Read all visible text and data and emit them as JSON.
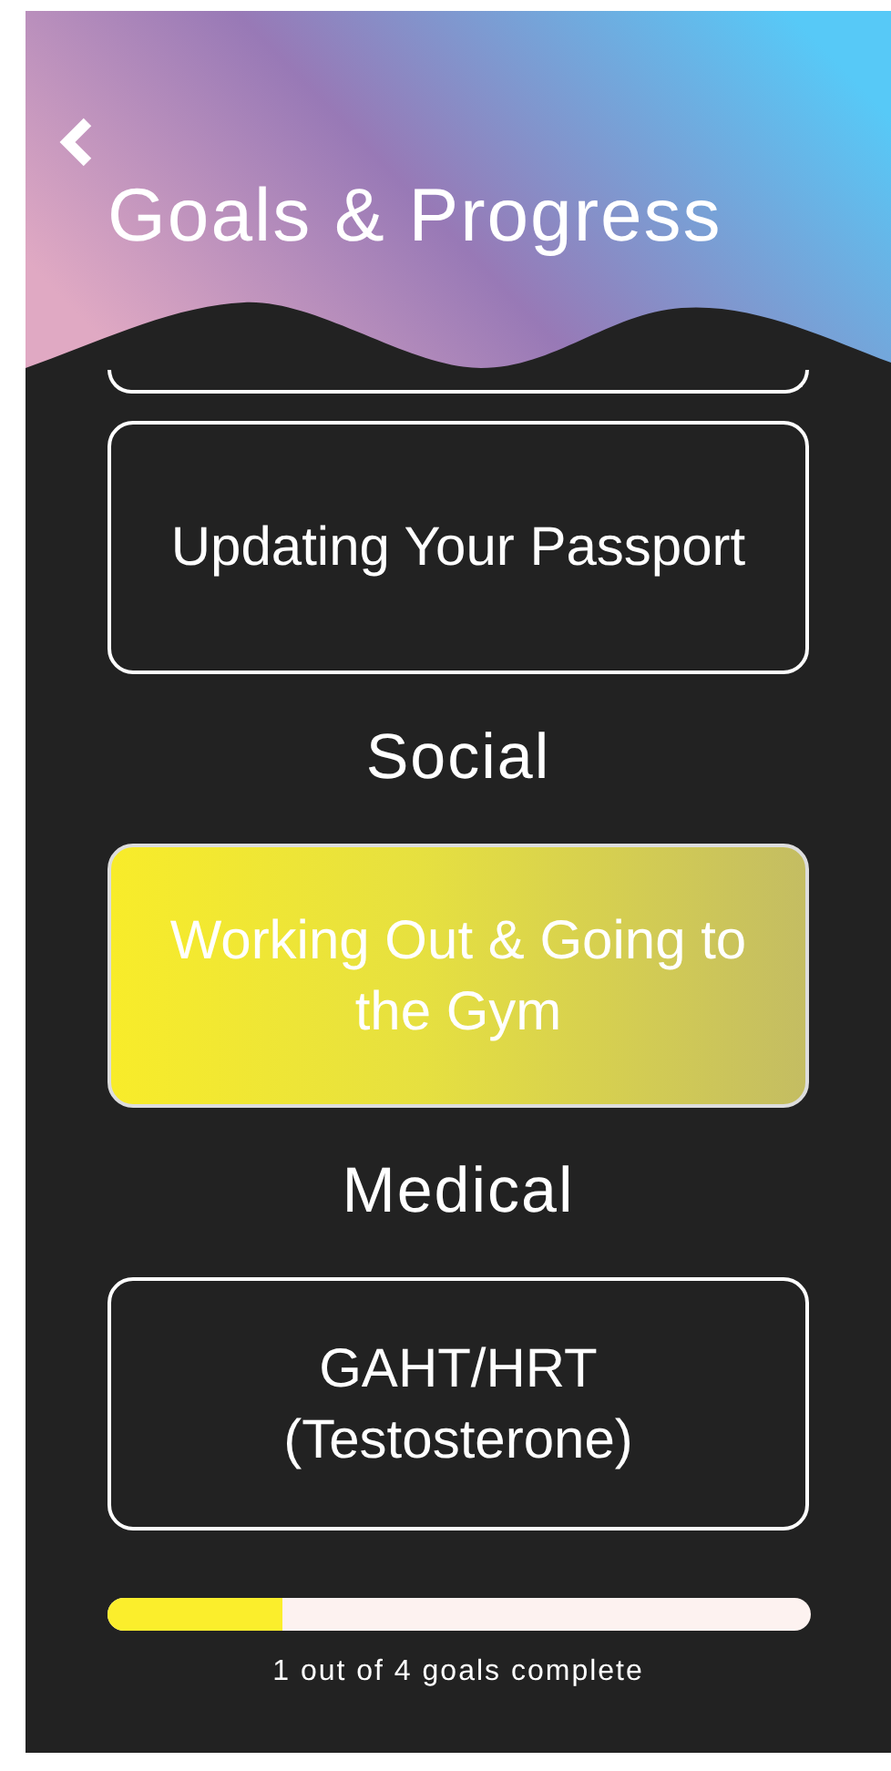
{
  "header": {
    "title": "Goals & Progress",
    "back_icon": true
  },
  "goal_above_hidden": true,
  "sections": [
    {
      "goals": [
        {
          "title": "Updating Your Passport",
          "completed": false
        }
      ]
    },
    {
      "heading": "Social",
      "goals": [
        {
          "title": "Working Out & Going to the Gym",
          "completed": true
        }
      ]
    },
    {
      "heading": "Medical",
      "goals": [
        {
          "title": "GAHT/HRT (Testosterone)",
          "completed": false
        }
      ]
    }
  ],
  "progress": {
    "level": 0.25,
    "caption": "1 out of 4 goals complete"
  }
}
